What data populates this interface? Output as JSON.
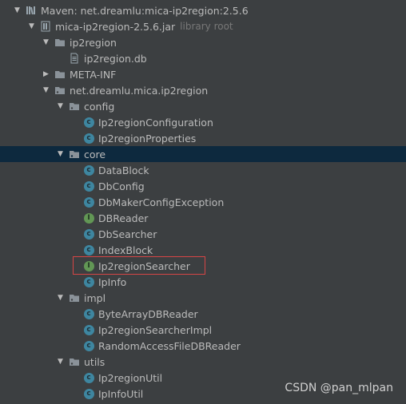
{
  "tree": {
    "rows": [
      {
        "label": "Maven: net.dreamlu:mica-ip2region:2.5.6",
        "hint": "",
        "icon": "maven-library-icon",
        "arrow": "expanded"
      },
      {
        "label": "mica-ip2region-2.5.6.jar",
        "hint": "library root",
        "icon": "jar-icon",
        "arrow": "expanded"
      },
      {
        "label": "ip2region",
        "hint": "",
        "icon": "folder-icon",
        "arrow": "expanded"
      },
      {
        "label": "ip2region.db",
        "hint": "",
        "icon": "file-icon",
        "arrow": "none"
      },
      {
        "label": "META-INF",
        "hint": "",
        "icon": "folder-icon",
        "arrow": "collapsed"
      },
      {
        "label": "net.dreamlu.mica.ip2region",
        "hint": "",
        "icon": "package-icon",
        "arrow": "expanded"
      },
      {
        "label": "config",
        "hint": "",
        "icon": "package-icon",
        "arrow": "expanded"
      },
      {
        "label": "Ip2regionConfiguration",
        "hint": "",
        "icon": "class-icon",
        "arrow": "none"
      },
      {
        "label": "Ip2regionProperties",
        "hint": "",
        "icon": "class-icon",
        "arrow": "none"
      },
      {
        "label": "core",
        "hint": "",
        "icon": "package-icon",
        "arrow": "expanded"
      },
      {
        "label": "DataBlock",
        "hint": "",
        "icon": "class-icon",
        "arrow": "none"
      },
      {
        "label": "DbConfig",
        "hint": "",
        "icon": "class-icon",
        "arrow": "none"
      },
      {
        "label": "DbMakerConfigException",
        "hint": "",
        "icon": "class-icon",
        "arrow": "none"
      },
      {
        "label": "DBReader",
        "hint": "",
        "icon": "interface-icon",
        "arrow": "none"
      },
      {
        "label": "DbSearcher",
        "hint": "",
        "icon": "class-icon",
        "arrow": "none"
      },
      {
        "label": "IndexBlock",
        "hint": "",
        "icon": "class-icon",
        "arrow": "none"
      },
      {
        "label": "Ip2regionSearcher",
        "hint": "",
        "icon": "interface-icon",
        "arrow": "none"
      },
      {
        "label": "IpInfo",
        "hint": "",
        "icon": "class-icon",
        "arrow": "none"
      },
      {
        "label": "impl",
        "hint": "",
        "icon": "package-icon",
        "arrow": "expanded"
      },
      {
        "label": "ByteArrayDBReader",
        "hint": "",
        "icon": "class-icon",
        "arrow": "none"
      },
      {
        "label": "Ip2regionSearcherImpl",
        "hint": "",
        "icon": "class-icon",
        "arrow": "none"
      },
      {
        "label": "RandomAccessFileDBReader",
        "hint": "",
        "icon": "class-icon",
        "arrow": "none"
      },
      {
        "label": "utils",
        "hint": "",
        "icon": "package-icon",
        "arrow": "expanded"
      },
      {
        "label": "Ip2regionUtil",
        "hint": "",
        "icon": "class-icon",
        "arrow": "none"
      },
      {
        "label": "IpInfoUtil",
        "hint": "",
        "icon": "class-icon",
        "arrow": "none"
      }
    ],
    "selected_label": "core",
    "highlighted_label": "Ip2regionSearcher"
  },
  "watermark": "CSDN @pan_mlpan",
  "colors": {
    "background": "#3c3f41",
    "selection": "#0d293e",
    "highlight_border": "#d64545",
    "class_icon": "#3e86a0",
    "interface_icon": "#629755"
  }
}
